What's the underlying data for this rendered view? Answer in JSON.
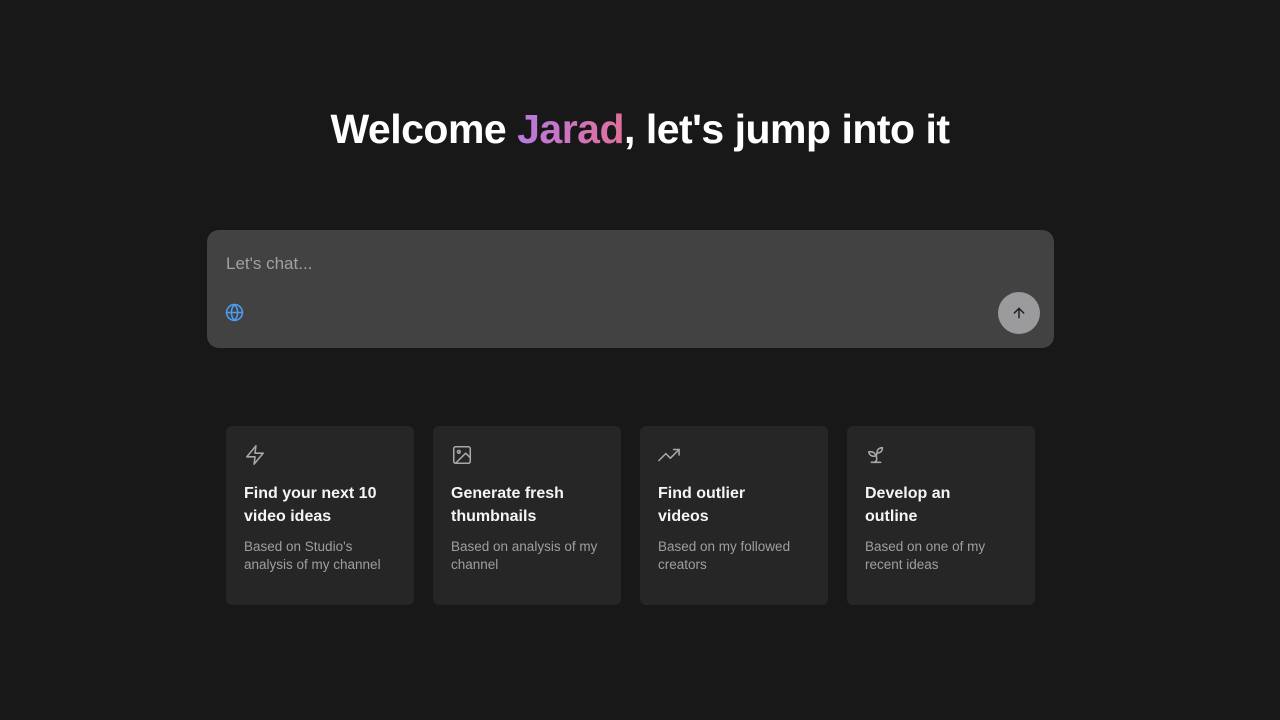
{
  "header": {
    "greeting_prefix": "Welcome ",
    "user_name": "Jarad",
    "greeting_suffix": ", let's jump into it"
  },
  "chat": {
    "placeholder": "Let's chat...",
    "value": "",
    "globe_icon": "globe-icon",
    "send_icon": "arrow-up-icon"
  },
  "colors": {
    "background": "#181819",
    "chat_box": "#424243",
    "card": "#262627",
    "name_gradient_start": "#b77ae0",
    "name_gradient_end": "#e0709a",
    "globe_accent": "#4a9df0"
  },
  "suggestions": [
    {
      "icon": "lightning-icon",
      "title": "Find your next 10 video ideas",
      "description": "Based on Studio's analysis of my channel"
    },
    {
      "icon": "image-icon",
      "title": "Generate fresh thumbnails",
      "description": "Based on analysis of my channel"
    },
    {
      "icon": "trending-up-icon",
      "title": "Find outlier videos",
      "description": "Based on my followed creators"
    },
    {
      "icon": "sprout-icon",
      "title": "Develop an outline",
      "description": "Based on one of my recent ideas"
    }
  ]
}
